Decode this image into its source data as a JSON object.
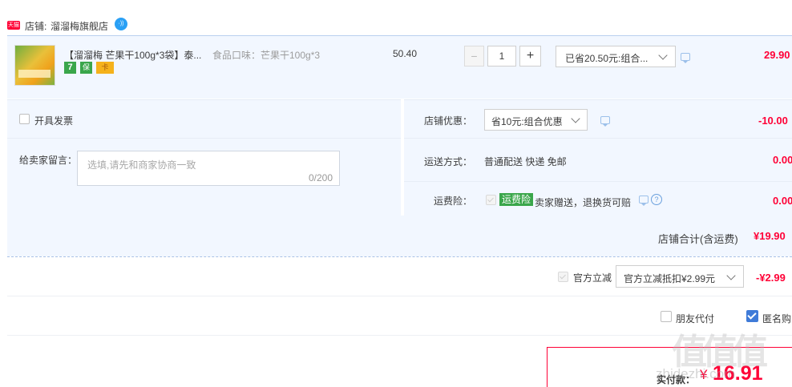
{
  "shop": {
    "badge": "天猫",
    "label": "店铺:",
    "name": "溜溜梅旗舰店",
    "wangwang": "·))"
  },
  "item": {
    "title": "【溜溜梅 芒果干100g*3袋】泰...",
    "sku": "食品口味：芒果干100g*3",
    "price": "50.40",
    "quantity": "1",
    "minus": "−",
    "plus": "+",
    "promo": "已省20.50元:组合...",
    "subtotal": "29.90",
    "badges": [
      "7",
      "保",
      "卡"
    ]
  },
  "invoice": {
    "label": "开具发票"
  },
  "message": {
    "label": "给卖家留言：",
    "placeholder": "选填,请先和商家协商一致",
    "counter": "0/200"
  },
  "shop_discount": {
    "label": "店铺优惠：",
    "value": "省10元:组合优惠",
    "amount": "-10.00"
  },
  "shipping": {
    "label": "运送方式：",
    "value": "普通配送 快递 免邮",
    "amount": "0.00"
  },
  "insurance": {
    "label": "运费险：",
    "tag": "运费险",
    "text": "卖家赠送，退换货可赔",
    "help": "?",
    "amount": "0.00"
  },
  "shop_total": {
    "label": "店铺合计(含运费)",
    "amount": "¥19.90"
  },
  "official": {
    "label": "官方立减",
    "select": "官方立减抵扣¥2.99元",
    "amount": "-¥2.99"
  },
  "options": {
    "friend_pay": "朋友代付",
    "anonymous": "匿名购"
  },
  "pay": {
    "label": "实付款：",
    "currency": "¥",
    "amount": "16.91"
  },
  "watermark": {
    "big": "值值值",
    "small": "zhidezhi.com"
  },
  "colors": {
    "accent": "#ff0036",
    "panel": "#f2f7ff",
    "blue": "#3f7bd8",
    "green": "#3aa64b"
  }
}
